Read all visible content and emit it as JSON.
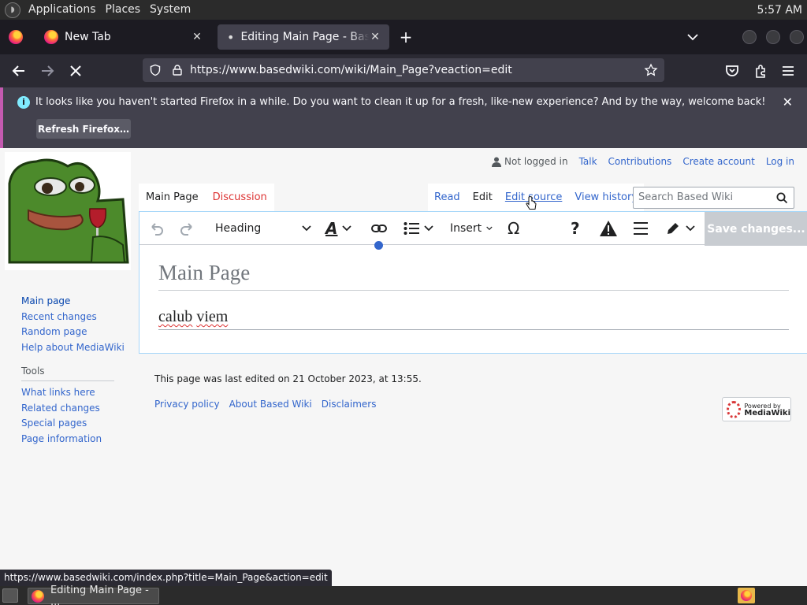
{
  "top_panel": {
    "menus": [
      "Applications",
      "Places",
      "System"
    ],
    "clock": "5:57 AM"
  },
  "browser": {
    "tabs": [
      {
        "label": "New Tab"
      },
      {
        "label": "Editing Main Page - Based Wiki"
      }
    ],
    "new_tab_symbol": "+",
    "url": "https://www.basedwiki.com/wiki/Main_Page?veaction=edit",
    "notification": {
      "message": "It looks like you haven't started Firefox in a while. Do you want to clean it up for a fresh, like-new experience? And by the way, welcome back!",
      "button": "Refresh Firefox…"
    },
    "status_link": "https://www.basedwiki.com/index.php?title=Main_Page&action=edit"
  },
  "wiki": {
    "user_links": {
      "status": "Not logged in",
      "talk": "Talk",
      "contributions": "Contributions",
      "create_account": "Create account",
      "login": "Log in"
    },
    "ns_tabs": {
      "main": "Main Page",
      "discussion": "Discussion"
    },
    "view_tabs": {
      "read": "Read",
      "edit": "Edit",
      "edit_source": "Edit source",
      "history": "View history"
    },
    "search_placeholder": "Search Based Wiki",
    "toolbar": {
      "format": "Heading",
      "insert": "Insert",
      "special_char": "Ω",
      "help": "?",
      "save": "Save changes..."
    },
    "page_title": "Main Page",
    "body_words": [
      "calub",
      "viem"
    ],
    "sidebar": [
      "Main page",
      "Recent changes",
      "Random page",
      "Help about MediaWiki"
    ],
    "tools_heading": "Tools",
    "tools": [
      "What links here",
      "Related changes",
      "Special pages",
      "Page information"
    ],
    "footer_info": "This page was last edited on 21 October 2023, at 13:55.",
    "footer_links": [
      "Privacy policy",
      "About Based Wiki",
      "Disclaimers"
    ],
    "powered_by": {
      "line1": "Powered by",
      "line2": "MediaWiki"
    }
  },
  "taskbar": {
    "window_label": "Editing Main Page - ..."
  },
  "colors": {
    "link": "#3366cc",
    "new_link": "#d33",
    "firefox_dark": "#1c1b22",
    "notification_accent": "#c45ab0"
  }
}
